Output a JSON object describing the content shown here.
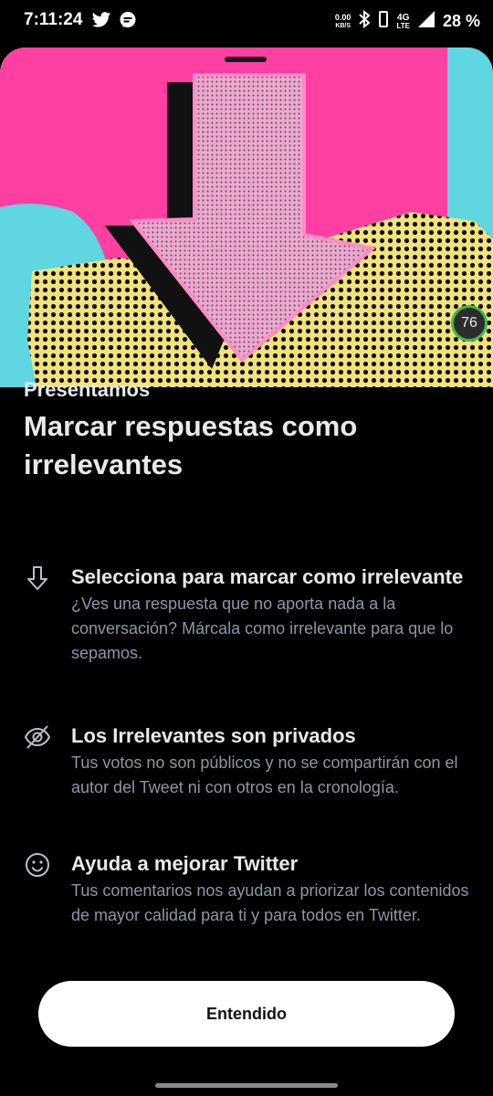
{
  "status_bar": {
    "time": "7:11:24",
    "net_speed_value": "0.00",
    "net_speed_unit": "KB/S",
    "network": "4G",
    "network_sub": "LTE",
    "battery": "28 %",
    "icons": [
      "twitter-icon",
      "chat-bubble-icon",
      "bluetooth-icon",
      "signal-icon"
    ]
  },
  "badge": {
    "value": "76"
  },
  "header": {
    "eyebrow": "Presentamos",
    "title": "Marcar respuestas como irrelevantes"
  },
  "features": [
    {
      "icon": "arrow-down-icon",
      "title": "Selecciona para marcar como irrelevante",
      "body": "¿Ves una respuesta que no aporta nada a la conversación? Márcala como irrelevante para que lo sepamos."
    },
    {
      "icon": "eye-off-icon",
      "title": "Los Irrelevantes son privados",
      "body": "Tus votos no son públicos y no se compartirán con el autor del Tweet ni con otros en la cronología."
    },
    {
      "icon": "smiley-icon",
      "title": "Ayuda a mejorar Twitter",
      "body": "Tus comentarios nos ayudan a priorizar los contenidos de mayor calidad para ti y para todos en Twitter."
    }
  ],
  "cta": {
    "label": "Entendido"
  },
  "colors": {
    "background": "#000000",
    "text_primary": "#e7e9ea",
    "text_secondary": "#8b98a5",
    "pink": "#ff3fa1",
    "cyan": "#5fd6e0",
    "yellow": "#f2e27a",
    "arrow": "#e7a7c9",
    "button_bg": "#ffffff"
  }
}
